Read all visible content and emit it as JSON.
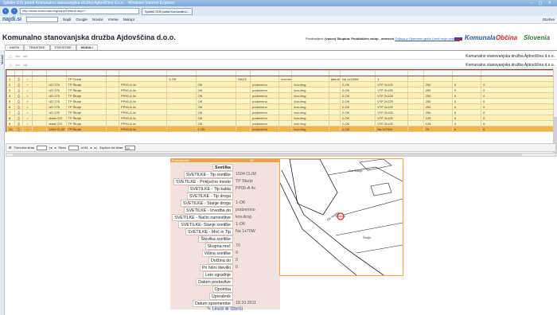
{
  "browser": {
    "title": "Spletni GIS portal Komunalno stanovanjska družba Ajdovščina d.o.o. - Windows Internet Explorer",
    "url": "http://www.komunala.si/gisapp/Default.aspx?...",
    "tab_label": "Spletni GIS portal Komunalno...",
    "window_controls": "– ▢ ✕"
  },
  "toolbar": {
    "brand": "najdi.si",
    "search_label": "Najdi",
    "google": "Google",
    "news": "Novice",
    "weather": "Vreme",
    "shopping": "Nakupi",
    "zoom": "Storitve"
  },
  "app": {
    "title": "Komunalno stanovanjska družba Ajdovščina d.o.o.",
    "user_prefix": "Pozdravljeni:",
    "user": "(vpsov) Skupina: Pooblaščen vstop - ameseni",
    "user_links": "Odjava iz  Spremeni geslo  Uredi moje podatke",
    "logo1": "Komunala",
    "logo2": "Občina",
    "logo3": "Slovenia"
  },
  "tabs": [
    "KARTA",
    "TEMATSKE",
    "STATISTIKE",
    "MODULI"
  ],
  "sidebar_label": "Moduli",
  "org_name_1": "Komunalno stanovanjska družba Ajdovščina d.o.o.",
  "org_name_2": "Komunalno stanovanjska družba Ajdovščina d.o.o.",
  "grid": {
    "rows": [
      [
        "1",
        "",
        "",
        "",
        "",
        "TP Cesta",
        "",
        "",
        "1-OK",
        "",
        "NADZ",
        "",
        "kov.neven",
        "",
        "jlad.olov",
        "Na 1x150W",
        "1",
        "",
        "",
        "",
        ""
      ],
      [
        "2",
        "",
        "",
        "",
        "UD 275",
        "TP Šturje",
        "",
        "PP00-A 4x",
        "",
        "OK",
        "",
        "podzemno",
        "",
        "kov.drog",
        "",
        "2-OK",
        "VTF 2x125",
        "",
        "250",
        "0",
        "0"
      ],
      [
        "3",
        "",
        "",
        "",
        "UD 275",
        "TP Šturje",
        "",
        "PP00-A 4x",
        "",
        "OK",
        "",
        "podzemno",
        "",
        "kov.drog",
        "",
        "2-OK",
        "VTF 2x125",
        "",
        "250",
        "0",
        "0"
      ],
      [
        "4",
        "",
        "",
        "",
        "UD 275",
        "TP Šturje",
        "",
        "PP00-A 4x",
        "",
        "OK",
        "",
        "podzemno",
        "",
        "kov.drog",
        "",
        "2-OK",
        "VTF 2x125",
        "",
        "250",
        "0",
        "0"
      ],
      [
        "5",
        "",
        "",
        "",
        "UD 275",
        "TP Šturje",
        "",
        "PP00-A 4x",
        "",
        "OK",
        "",
        "podzemno",
        "",
        "kov.drog",
        "",
        "2-OK",
        "VTF 2x125",
        "",
        "250",
        "0",
        "0"
      ],
      [
        "6",
        "",
        "",
        "",
        "UD 275",
        "TP Šturje",
        "",
        "PP00-A 4x",
        "",
        "OK",
        "",
        "podzemno",
        "",
        "kov.drog",
        "",
        "2-OK",
        "VTF 2x125",
        "",
        "250",
        "0",
        "0"
      ],
      [
        "7",
        "",
        "",
        "",
        "UD 275",
        "TP Šturje",
        "",
        "PP00-A 4x",
        "",
        "OK",
        "",
        "podzemno",
        "",
        "kov.drog",
        "",
        "2-OK",
        "VTF 2x125",
        "",
        "250",
        "0",
        "0"
      ],
      [
        "8",
        "",
        "",
        "",
        "stara CIS",
        "TP Šturje",
        "",
        "PP00-A 4x",
        "",
        "OK",
        "",
        "podzemno",
        "",
        "kov.drog",
        "",
        "2-OK",
        "VTF 2x125",
        "",
        "125",
        "0",
        "0"
      ],
      [
        "9",
        "",
        "",
        "",
        "stara CIS",
        "TP Šturje",
        "",
        "PP00-A 4x",
        "",
        "OK",
        "",
        "podzemno",
        "",
        "kov.drog",
        "",
        "2-OK",
        "VTF 2x125",
        "",
        "125",
        "0",
        "0"
      ],
      [
        "10",
        "",
        "",
        "",
        "1504 CLIM",
        "TP Šturje",
        "",
        "PP00-A 4x",
        "",
        "1-OK",
        "",
        "podzemno",
        "",
        "kov.drog",
        "",
        "1-OK",
        "Na 1x70W",
        "",
        "70",
        "0",
        "0"
      ]
    ]
  },
  "pager": {
    "label1": "Trenutna stran",
    "page_word": "Stran",
    "page_of": "of 81",
    "label2": "Zapisov na stran",
    "per_page": "10"
  },
  "detail": {
    "caption": "Podrobnosti",
    "caption_id": "10",
    "fields": [
      {
        "label": "Svetilka",
        "value": ""
      },
      {
        "label": "SVETILKE - Tip svetilke",
        "value": "1504 CLIM"
      },
      {
        "label": "SVETILKE - Priključno mesto",
        "value": "TP Šturje"
      },
      {
        "label": "SVETILKE - Tip kabla",
        "value": "PP00-A 4x"
      },
      {
        "label": "SVETILKE - Tip droga",
        "value": ""
      },
      {
        "label": "SVETILKE - Stanje droga",
        "value": "1-OK"
      },
      {
        "label": "SVETILKE - Izvedba do",
        "value": "podzemno"
      },
      {
        "label": "SVETILKE - Način namestitve",
        "value": "kov.drog"
      },
      {
        "label": "SVETILKE- Stanje svetilke",
        "value": "1-OK"
      },
      {
        "label": "SVETILKE - Moč in Tip",
        "value": "Na 1x70W"
      },
      {
        "label": "Številka svetilke",
        "value": ""
      },
      {
        "label": "Skupna moč",
        "value": "70"
      },
      {
        "label": "Višina svetilke",
        "value": "0"
      },
      {
        "label": "Dolžina do",
        "value": "0"
      },
      {
        "label": "Pri hišni številki",
        "value": "0"
      },
      {
        "label": "Leto vgradnje",
        "value": ""
      },
      {
        "label": "Datum postavitve",
        "value": ""
      },
      {
        "label": "Opomba",
        "value": ""
      },
      {
        "label": "Uporabnik",
        "value": ""
      },
      {
        "label": "Datum spremembe",
        "value": "18.10.2011"
      }
    ],
    "edit": "Uredi",
    "delete": "Izbriši"
  },
  "map": {
    "labels": [
      "Pot Šturje",
      "Ob Hublju",
      "Šturje"
    ]
  },
  "colors": {
    "selected_row": "#f6b24a",
    "row": "#fff6c8",
    "accent": "#f0a24a"
  }
}
